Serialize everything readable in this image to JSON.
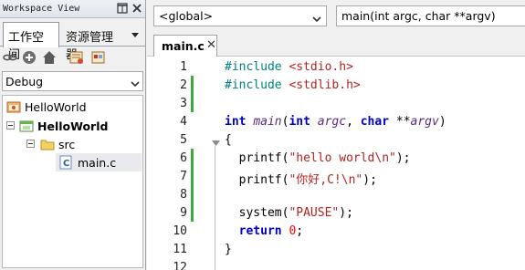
{
  "workspace": {
    "title": "Workspace View",
    "tabs": [
      "工作空间",
      "资源管理器"
    ],
    "config": "Debug",
    "tree": [
      {
        "label": "HelloWorld",
        "kind": "workspace",
        "bold": false
      },
      {
        "label": "HelloWorld",
        "kind": "project",
        "bold": true
      },
      {
        "label": "src",
        "kind": "folder",
        "bold": false
      },
      {
        "label": "main.c",
        "kind": "file",
        "bold": false
      }
    ]
  },
  "editor": {
    "scope": "<global>",
    "function": "main(int argc, char **argv)",
    "file_tab": "main.c",
    "close_glyph": "✕",
    "line_numbers": [
      "1",
      "2",
      "3",
      "4",
      "5",
      "6",
      "7",
      "8",
      "9",
      "10",
      "11",
      "12"
    ],
    "changed_lines": [
      2,
      3,
      6,
      7,
      8,
      9
    ],
    "lines": [
      [
        {
          "t": "#include ",
          "c": "pp"
        },
        {
          "t": "<stdio.h>",
          "c": "inc"
        }
      ],
      [
        {
          "t": "#include ",
          "c": "pp"
        },
        {
          "t": "<stdlib.h>",
          "c": "inc"
        }
      ],
      [],
      [
        {
          "t": "int",
          "c": "kw"
        },
        {
          "t": " ",
          "c": ""
        },
        {
          "t": "main",
          "c": "it"
        },
        {
          "t": "(",
          "c": ""
        },
        {
          "t": "int",
          "c": "kw"
        },
        {
          "t": " ",
          "c": ""
        },
        {
          "t": "argc",
          "c": "it"
        },
        {
          "t": ", ",
          "c": ""
        },
        {
          "t": "char",
          "c": "kw"
        },
        {
          "t": " **",
          "c": ""
        },
        {
          "t": "argv",
          "c": "it"
        },
        {
          "t": ")",
          "c": ""
        }
      ],
      [
        {
          "t": "{",
          "c": ""
        }
      ],
      [
        {
          "t": "  printf(",
          "c": ""
        },
        {
          "t": "\"hello world\\n\"",
          "c": "str"
        },
        {
          "t": ");",
          "c": ""
        }
      ],
      [
        {
          "t": "  printf(",
          "c": ""
        },
        {
          "t": "\"你好,C!\\n\"",
          "c": "str"
        },
        {
          "t": ");",
          "c": ""
        }
      ],
      [],
      [
        {
          "t": "  system(",
          "c": ""
        },
        {
          "t": "\"PAUSE\"",
          "c": "str"
        },
        {
          "t": ");",
          "c": ""
        }
      ],
      [
        {
          "t": "  ",
          "c": ""
        },
        {
          "t": "return",
          "c": "kw"
        },
        {
          "t": " ",
          "c": ""
        },
        {
          "t": "0",
          "c": "num"
        },
        {
          "t": ";",
          "c": ""
        }
      ],
      [
        {
          "t": "}",
          "c": ""
        }
      ],
      []
    ]
  },
  "colors": {
    "change_bar": "#3caa3c",
    "keyword": "#0000cc",
    "string": "#b22222"
  },
  "icons": [
    "restore-icon",
    "close-icon",
    "link-icon",
    "add-icon",
    "home-icon",
    "build-icon",
    "clean-icon",
    "workspace-icon",
    "project-icon",
    "folder-icon",
    "c-file-icon",
    "fold-icon"
  ]
}
